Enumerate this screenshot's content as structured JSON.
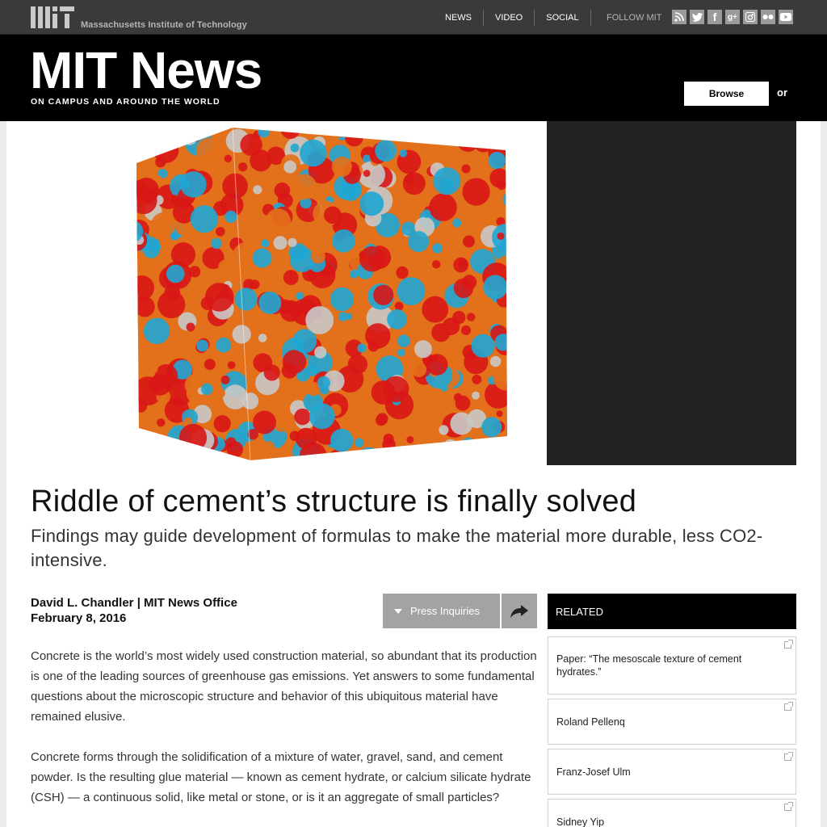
{
  "top_bar": {
    "institution": "Massachusetts Institute of Technology",
    "nav": [
      "NEWS",
      "VIDEO",
      "SOCIAL"
    ],
    "follow_label": "FOLLOW MIT",
    "social_icons": [
      "rss-icon",
      "twitter-icon",
      "facebook-icon",
      "google-plus-icon",
      "instagram-icon",
      "flickr-icon",
      "youtube-icon"
    ]
  },
  "header": {
    "brand": "MIT News",
    "tagline": "ON CAMPUS AND AROUND THE WORLD",
    "browse_label": "Browse",
    "or_label": "or"
  },
  "article": {
    "title": "Riddle of cement’s structure is finally solved",
    "subtitle": "Findings may guide development of formulas to make the material more durable, less CO2-intensive.",
    "author": "David L. Chandler | MIT News Office",
    "date": "February 8, 2016",
    "press_label": "Press Inquiries",
    "paragraphs": [
      "Concrete is the world’s most widely used construction material, so abundant that its production is one of the leading sources of greenhouse gas emissions. Yet answers to some fundamental questions about the microscopic structure and behavior of this ubiquitous material have remained elusive.",
      "Concrete forms through the solidification of a mixture of water, gravel, sand, and cement powder. Is the resulting glue material — known as cement hydrate, or calcium silicate hydrate (CSH) — a continuous solid, like metal or stone, or is it an aggregate of small particles?"
    ]
  },
  "related": {
    "heading": "RELATED",
    "items": [
      "Paper: “The mesoscale texture of cement hydrates.”",
      "Roland Pellenq",
      "Franz-Josef Ulm",
      "Sidney Yip"
    ]
  },
  "colors": {
    "header_bg": "#000000",
    "topbar_bg": "#3a3a3a",
    "button_gray": "#a3a3a3"
  }
}
